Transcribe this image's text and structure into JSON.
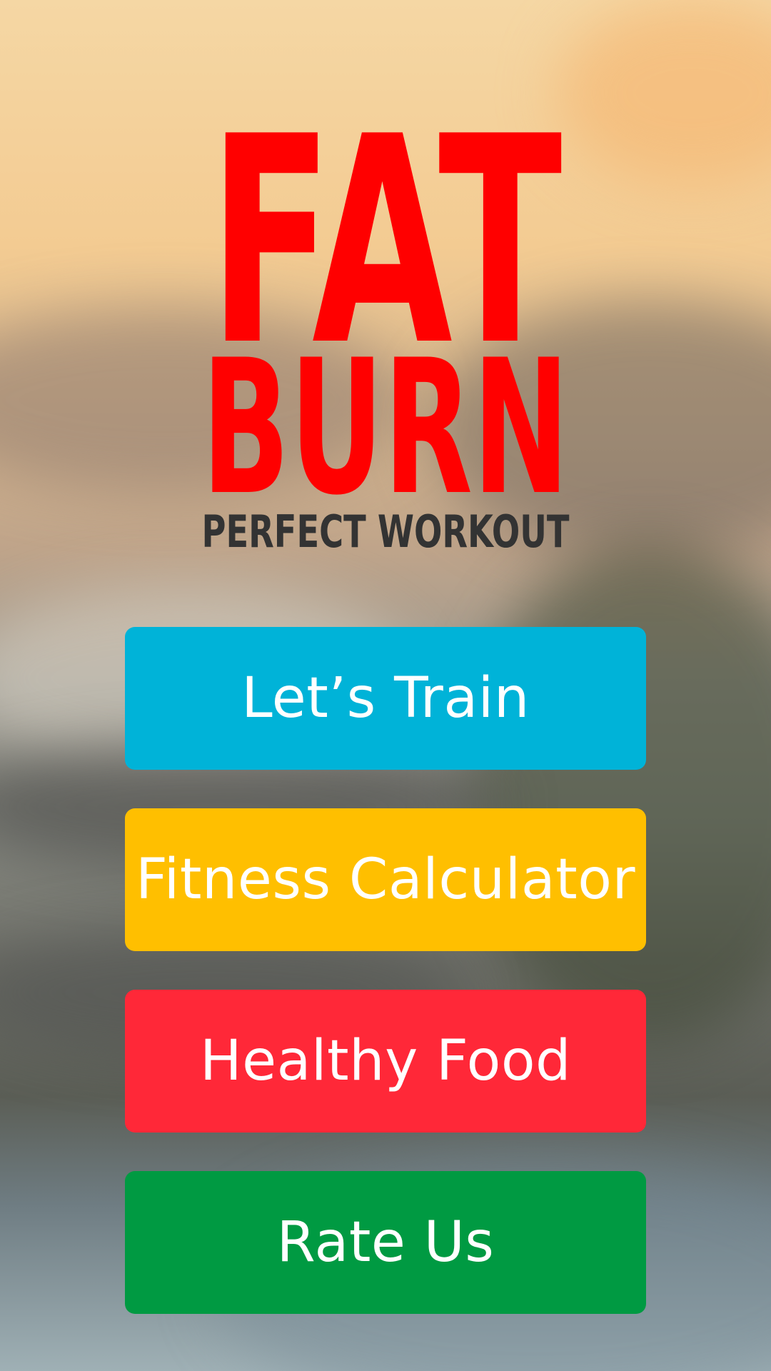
{
  "app": {
    "logo": {
      "line1": "FAT",
      "line2": "BURN",
      "tagline": "PERFECT WORKOUT"
    },
    "menu": [
      {
        "label": "Let’s Train",
        "color": "#00b3d8"
      },
      {
        "label": "Fitness Calculator",
        "color": "#ffbf00"
      },
      {
        "label": "Healthy Food",
        "color": "#ff2838"
      },
      {
        "label": "Rate Us",
        "color": "#009a42"
      }
    ]
  }
}
